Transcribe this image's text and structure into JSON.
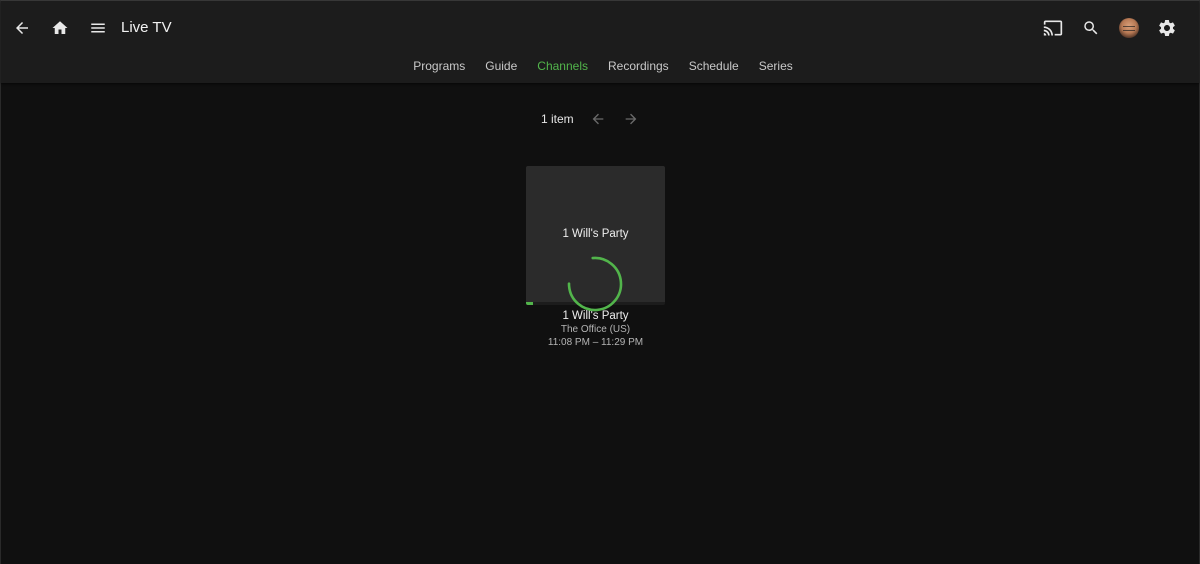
{
  "header": {
    "title": "Live TV",
    "icons": {
      "back": "arrow-back-icon",
      "home": "home-icon",
      "menu": "menu-icon",
      "cast": "cast-icon",
      "search": "search-icon",
      "avatar": "user-avatar",
      "settings": "settings-gear-icon"
    }
  },
  "tabs": [
    {
      "label": "Programs",
      "active": false
    },
    {
      "label": "Guide",
      "active": false
    },
    {
      "label": "Channels",
      "active": true
    },
    {
      "label": "Recordings",
      "active": false
    },
    {
      "label": "Schedule",
      "active": false
    },
    {
      "label": "Series",
      "active": false
    }
  ],
  "pager": {
    "count_label": "1 item"
  },
  "channels": [
    {
      "image_text": "1 Will's Party",
      "title": "1 Will's Party",
      "program": "The Office (US)",
      "time": "11:08 PM – 11:29 PM",
      "progress_fraction": 0.05
    }
  ],
  "colors": {
    "accent": "#52b54b",
    "header_bg": "#1c1c1c",
    "page_bg": "#101010",
    "card_bg": "#2b2b2b"
  }
}
